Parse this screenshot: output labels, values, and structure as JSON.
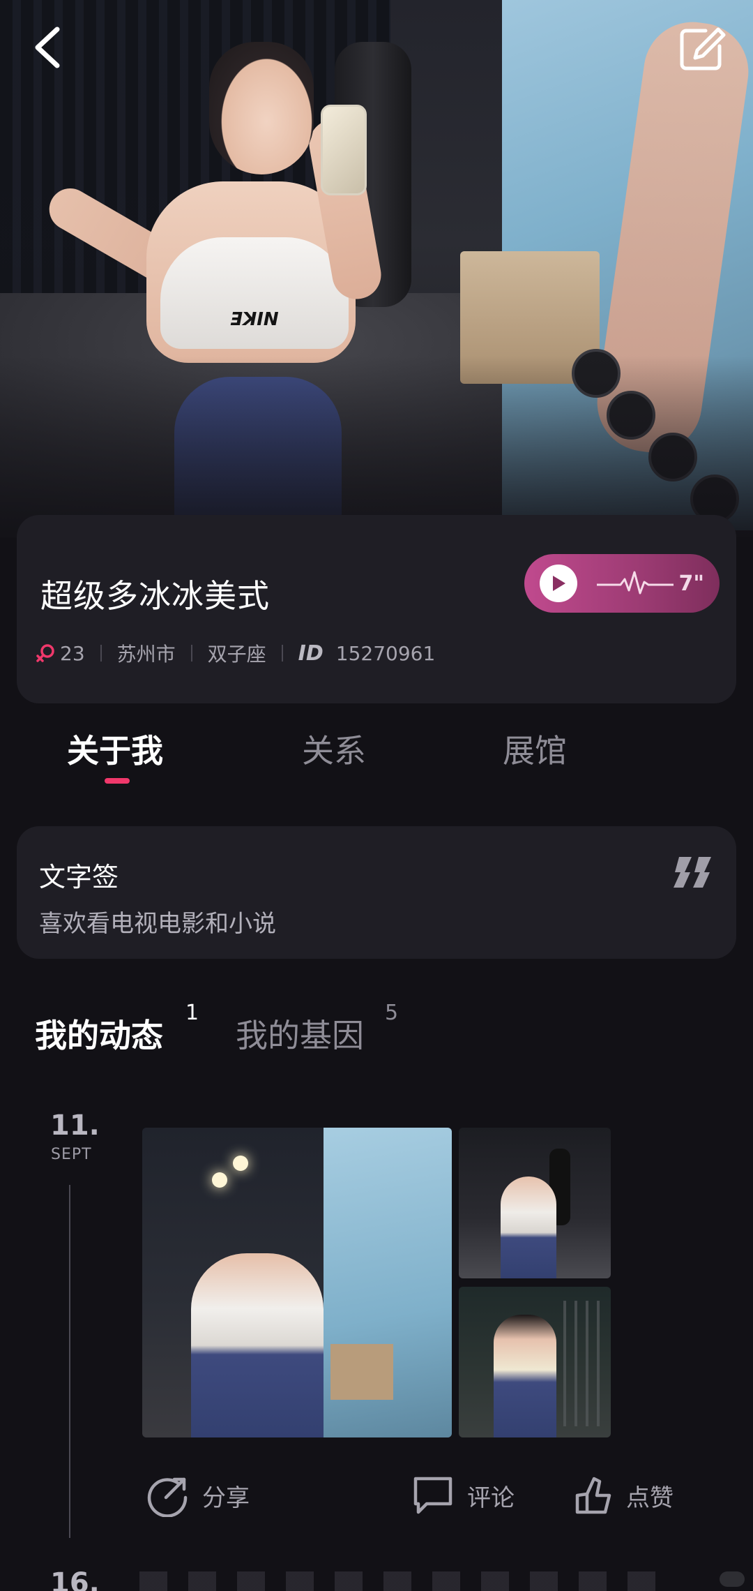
{
  "profile": {
    "name": "超级多冰冰美式",
    "age": "23",
    "city": "苏州市",
    "zodiac": "双子座",
    "id_label": "ID",
    "id_value": "15270961",
    "voice_duration": "7\""
  },
  "tabs": [
    {
      "label": "关于我",
      "active": true
    },
    {
      "label": "关系",
      "active": false
    },
    {
      "label": "展馆",
      "active": false
    }
  ],
  "signature": {
    "title": "文字签",
    "text": "喜欢看电视电影和小说"
  },
  "feed_tabs": [
    {
      "label": "我的动态",
      "count": "1",
      "active": true
    },
    {
      "label": "我的基因",
      "count": "5",
      "active": false
    }
  ],
  "posts": [
    {
      "day": "11.",
      "month": "SEPT"
    },
    {
      "day": "16."
    }
  ],
  "actions": {
    "share": "分享",
    "comment": "评论",
    "like": "点赞"
  },
  "colors": {
    "background": "#121116",
    "card": "#1f1e25",
    "accent_pink": "#f0386b",
    "voice_gradient_start": "#c04a8e",
    "voice_gradient_end": "#7e2e5c"
  },
  "icons": [
    "back-arrow-icon",
    "edit-icon",
    "female-icon",
    "play-icon",
    "waveform-icon",
    "quote-icon",
    "share-icon",
    "comment-icon",
    "like-icon"
  ]
}
